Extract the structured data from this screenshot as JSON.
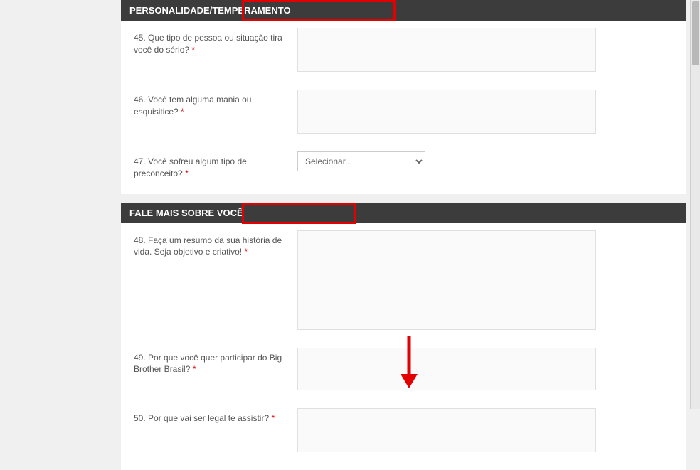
{
  "sections": [
    {
      "title": "PERSONALIDADE/TEMPERAMENTO",
      "questions": [
        {
          "num": "45.",
          "text": "Que tipo de pessoa ou situação tira você do sério?",
          "type": "textarea",
          "size": "small"
        },
        {
          "num": "46.",
          "text": "Você tem alguma mania ou esquisitice?",
          "type": "textarea",
          "size": "small"
        },
        {
          "num": "47.",
          "text": "Você sofreu algum tipo de preconceito?",
          "type": "select",
          "placeholder": "Selecionar..."
        }
      ]
    },
    {
      "title": "FALE MAIS SOBRE VOCÊ",
      "questions": [
        {
          "num": "48.",
          "text": "Faça um resumo da sua história de vida. Seja objetivo e criativo!",
          "type": "textarea",
          "size": "large"
        },
        {
          "num": "49.",
          "text": "Por que você quer participar do Big Brother Brasil?",
          "type": "textarea",
          "size": "medium"
        },
        {
          "num": "50.",
          "text": "Por que vai ser legal te assistir?",
          "type": "textarea",
          "size": "small"
        }
      ]
    }
  ],
  "required_marker": "*"
}
